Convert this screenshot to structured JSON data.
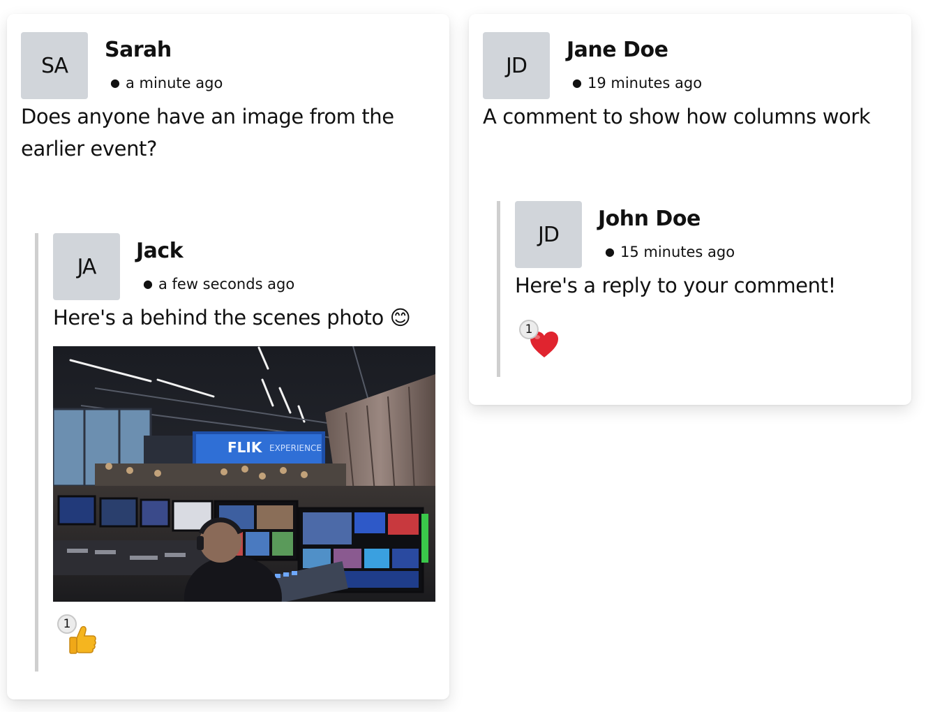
{
  "comments": [
    {
      "author": "Sarah",
      "initials": "SA",
      "time": "a minute ago",
      "text": "Does anyone have an image from the earlier event?",
      "replies": [
        {
          "author": "Jack",
          "initials": "JA",
          "time": "a few seconds ago",
          "text": "Here's a behind the scenes photo 😊",
          "image": {
            "alt": "Behind the scenes photo of a broadcast control room",
            "sign_text": "FLIK"
          },
          "reactions": [
            {
              "emoji": "thumbs-up-icon",
              "count": "1"
            }
          ]
        }
      ]
    },
    {
      "author": "Jane Doe",
      "initials": "JD",
      "time": "19 minutes ago",
      "text": "A comment to show how columns work",
      "replies": [
        {
          "author": "John Doe",
          "initials": "JD",
          "time": "15 minutes ago",
          "text": "Here's a reply to your comment!",
          "reactions": [
            {
              "emoji": "heart-icon",
              "count": "1"
            }
          ]
        }
      ]
    }
  ],
  "colors": {
    "avatar_bg": "#d1d5da",
    "thread_line": "#cfcfcf",
    "heart": "#e0242f",
    "thumb": "#f5b51f"
  }
}
